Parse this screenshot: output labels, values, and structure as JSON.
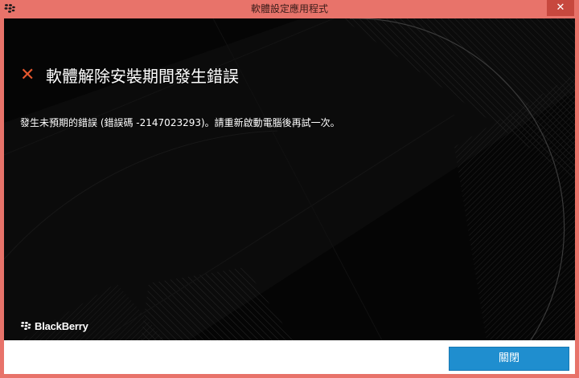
{
  "window": {
    "title": "軟體設定應用程式"
  },
  "error": {
    "title": "軟體解除安裝期間發生錯誤",
    "message": "發生未預期的錯誤 (錯誤碼 -2147023293)。請重新啟動電腦後再試一次。"
  },
  "brand": {
    "name": "BlackBerry"
  },
  "footer": {
    "close_label": "關閉"
  },
  "colors": {
    "titlebar": "#e8736a",
    "accent_error": "#e4572e",
    "button": "#1f8ecf",
    "content_bg": "#050505"
  },
  "icons": {
    "app": "blackberry-logo-icon",
    "error": "close-icon",
    "brand": "blackberry-logo-icon"
  }
}
